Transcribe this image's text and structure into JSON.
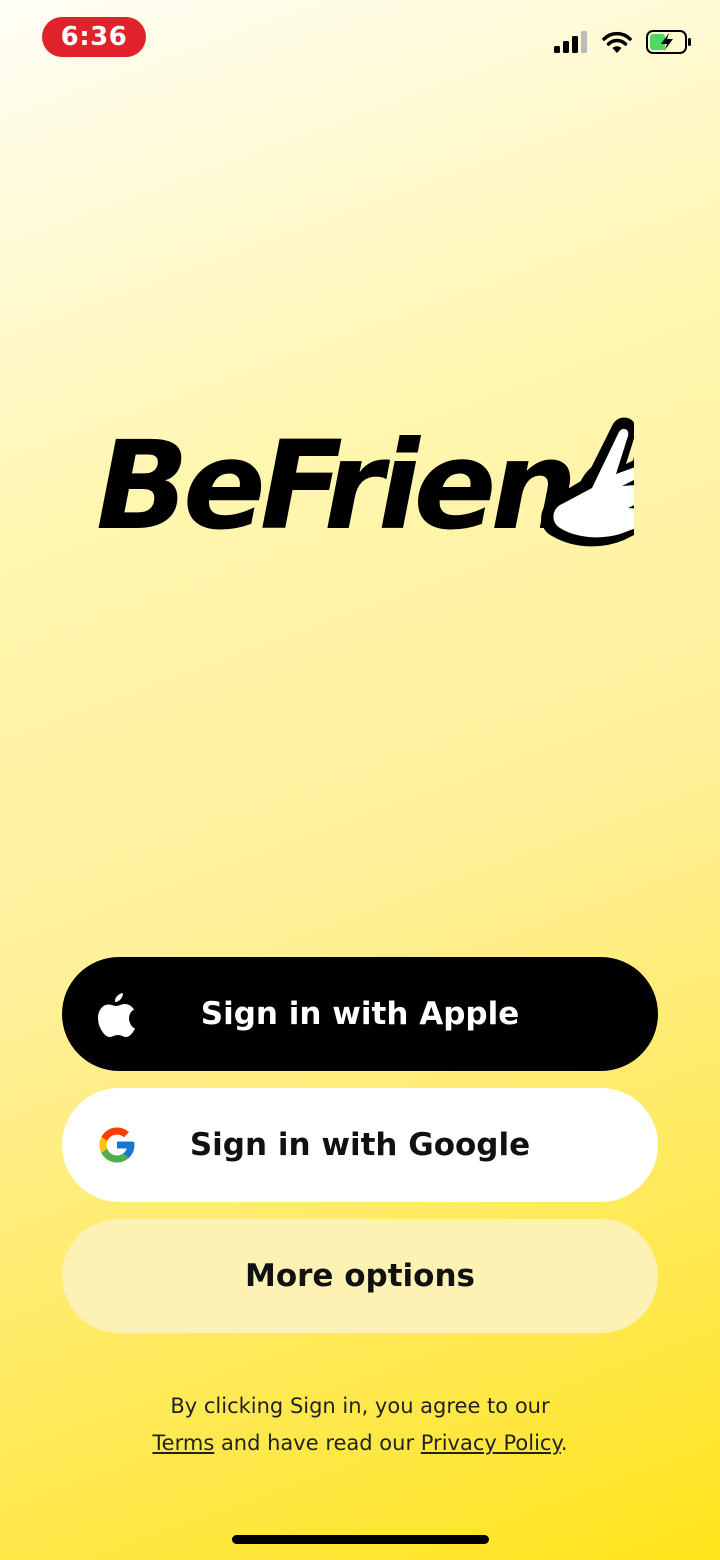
{
  "status_bar": {
    "time": "6:36",
    "icons": [
      "signal-icon",
      "wifi-icon",
      "battery-charging-icon"
    ]
  },
  "brand": {
    "name": "BeFriend",
    "logo_icon": "pointing-hand-icon"
  },
  "buttons": {
    "apple_label": "Sign in with Apple",
    "apple_icon": "apple-icon",
    "google_label": "Sign in with Google",
    "google_icon": "google-icon",
    "more_label": "More options"
  },
  "legal": {
    "line1": "By clicking Sign in, you agree to our",
    "terms_link": "Terms",
    "middle": " and have read our ",
    "privacy_link": "Privacy Policy",
    "end": "."
  },
  "colors": {
    "accent_yellow": "#ffe41a",
    "apple_button": "#000000",
    "google_button": "#ffffff",
    "more_button": "#fdf2b4",
    "time_pill": "#e0222b"
  }
}
